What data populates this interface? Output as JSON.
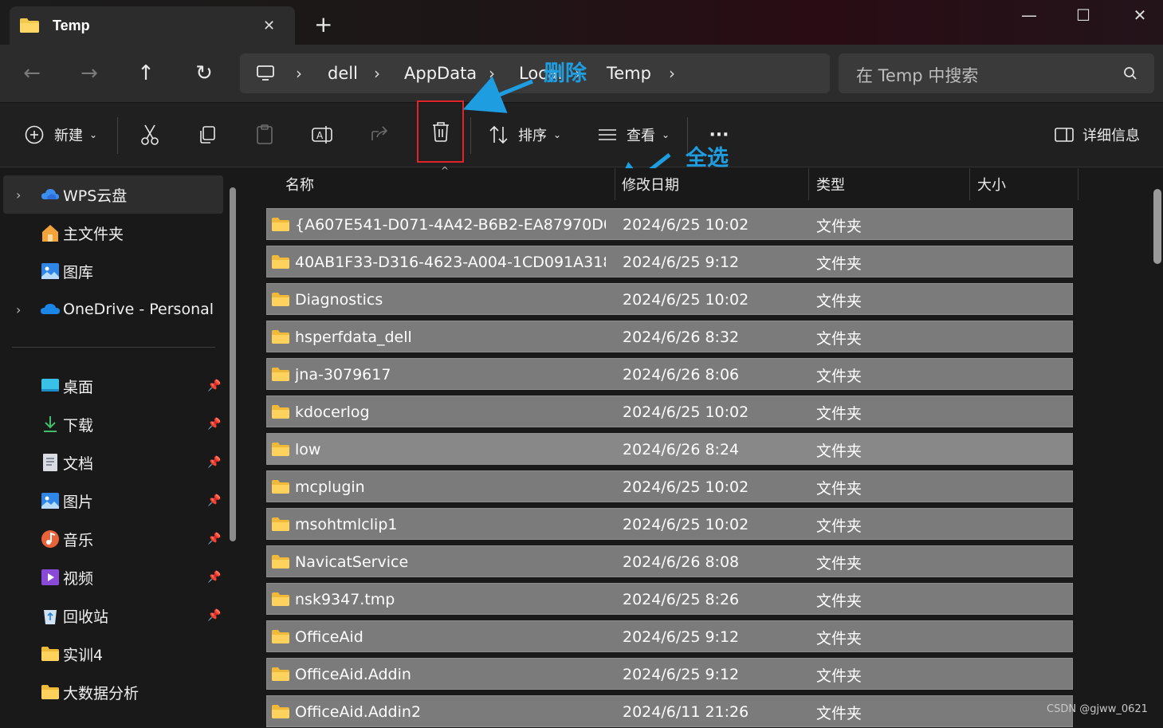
{
  "window": {
    "tab_title": "Temp",
    "tab_close": "✕",
    "new_tab": "+",
    "minimize": "—",
    "maximize": "☐",
    "close": "✕"
  },
  "nav": {
    "back": "←",
    "forward": "→",
    "up": "↑",
    "refresh": "↻",
    "breadcrumbs": [
      "dell",
      "AppData",
      "Local",
      "Temp"
    ],
    "search_placeholder": "在 Temp 中搜索"
  },
  "toolbar": {
    "new_label": "新建",
    "sort_label": "排序",
    "view_label": "查看",
    "more_label": "···",
    "details_label": "详细信息"
  },
  "annotations": {
    "delete": "删除",
    "select_all": "全选"
  },
  "sidebar": {
    "top_items": [
      {
        "label": "WPS云盘",
        "icon": "cloud-icon",
        "expandable": true,
        "selected": true
      },
      {
        "label": "主文件夹",
        "icon": "home-icon",
        "expandable": false
      },
      {
        "label": "图库",
        "icon": "gallery-icon",
        "expandable": false
      },
      {
        "label": "OneDrive - Personal",
        "icon": "onedrive-icon",
        "expandable": true
      }
    ],
    "pinned_items": [
      {
        "label": "桌面",
        "icon": "desktop-icon",
        "pinned": true
      },
      {
        "label": "下载",
        "icon": "download-icon",
        "pinned": true
      },
      {
        "label": "文档",
        "icon": "documents-icon",
        "pinned": true
      },
      {
        "label": "图片",
        "icon": "pictures-icon",
        "pinned": true
      },
      {
        "label": "音乐",
        "icon": "music-icon",
        "pinned": true
      },
      {
        "label": "视频",
        "icon": "video-icon",
        "pinned": true
      },
      {
        "label": "回收站",
        "icon": "recycle-bin-icon",
        "pinned": true
      },
      {
        "label": "实训4",
        "icon": "folder-icon",
        "pinned": false
      },
      {
        "label": "大数据分析",
        "icon": "folder-icon",
        "pinned": false
      }
    ]
  },
  "columns": {
    "name": "名称",
    "date": "修改日期",
    "type": "类型",
    "size": "大小"
  },
  "files": [
    {
      "name": "{A607E541-D071-4A42-B6B2-EA87970D07...",
      "date": "2024/6/25 10:02",
      "type": "文件夹"
    },
    {
      "name": "40AB1F33-D316-4623-A004-1CD091A318...",
      "date": "2024/6/25 9:12",
      "type": "文件夹"
    },
    {
      "name": "Diagnostics",
      "date": "2024/6/25 10:02",
      "type": "文件夹"
    },
    {
      "name": "hsperfdata_dell",
      "date": "2024/6/26 8:32",
      "type": "文件夹"
    },
    {
      "name": "jna-3079617",
      "date": "2024/6/26 8:06",
      "type": "文件夹"
    },
    {
      "name": "kdocerlog",
      "date": "2024/6/25 10:02",
      "type": "文件夹"
    },
    {
      "name": "low",
      "date": "2024/6/26 8:24",
      "type": "文件夹"
    },
    {
      "name": "mcplugin",
      "date": "2024/6/25 10:02",
      "type": "文件夹"
    },
    {
      "name": "msohtmlclip1",
      "date": "2024/6/25 10:02",
      "type": "文件夹"
    },
    {
      "name": "NavicatService",
      "date": "2024/6/26 8:08",
      "type": "文件夹"
    },
    {
      "name": "nsk9347.tmp",
      "date": "2024/6/25 8:26",
      "type": "文件夹"
    },
    {
      "name": "OfficeAid",
      "date": "2024/6/25 9:12",
      "type": "文件夹"
    },
    {
      "name": "OfficeAid.Addin",
      "date": "2024/6/25 9:12",
      "type": "文件夹"
    },
    {
      "name": "OfficeAid.Addin2",
      "date": "2024/6/11 21:26",
      "type": "文件夹"
    }
  ],
  "watermark": "CSDN @gjww_0621",
  "colors": {
    "accent": "#1e9de0",
    "highlight_box": "#e0242b",
    "row_selected": "#7b7b7b"
  }
}
